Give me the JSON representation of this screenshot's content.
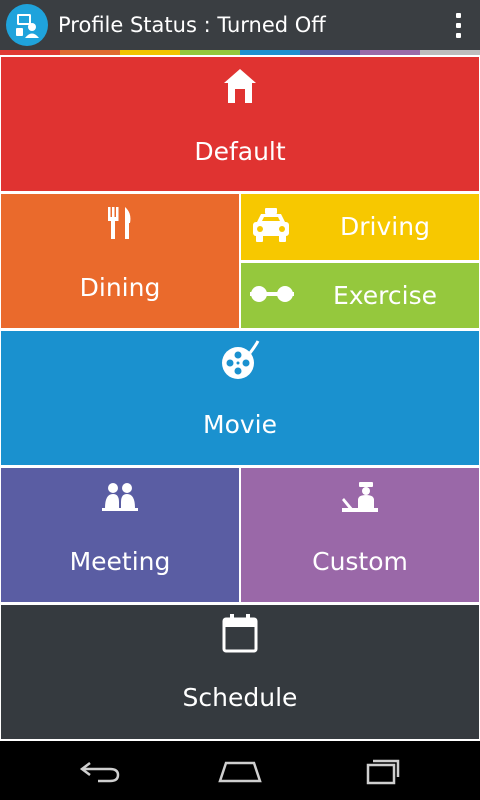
{
  "app": {
    "title": "Profile Status : Turned Off",
    "icon": "profile-app-icon",
    "accent": "#1fa3dc"
  },
  "stripe_colors": [
    "#e03a34",
    "#e06a2f",
    "#f2c400",
    "#94c83d",
    "#1d91cf",
    "#5a5ea1",
    "#9b6aa8",
    "#bdbdbd"
  ],
  "tiles": {
    "default": {
      "label": "Default",
      "color": "#e03331",
      "icon": "home-icon"
    },
    "dining": {
      "label": "Dining",
      "color": "#ea6a2c",
      "icon": "fork-knife-icon"
    },
    "driving": {
      "label": "Driving",
      "color": "#f7c800",
      "icon": "taxi-icon"
    },
    "exercise": {
      "label": "Exercise",
      "color": "#95c83d",
      "icon": "dumbbell-icon"
    },
    "movie": {
      "label": "Movie",
      "color": "#1a91cf",
      "icon": "film-reel-icon"
    },
    "meeting": {
      "label": "Meeting",
      "color": "#5a5da3",
      "icon": "people-icon"
    },
    "custom": {
      "label": "Custom",
      "color": "#9a68a8",
      "icon": "officer-desk-icon"
    },
    "schedule": {
      "label": "Schedule",
      "color": "#353a3f",
      "icon": "calendar-icon"
    }
  },
  "navbar": {
    "back": "back-icon",
    "home": "home-nav-icon",
    "recents": "recents-icon"
  }
}
